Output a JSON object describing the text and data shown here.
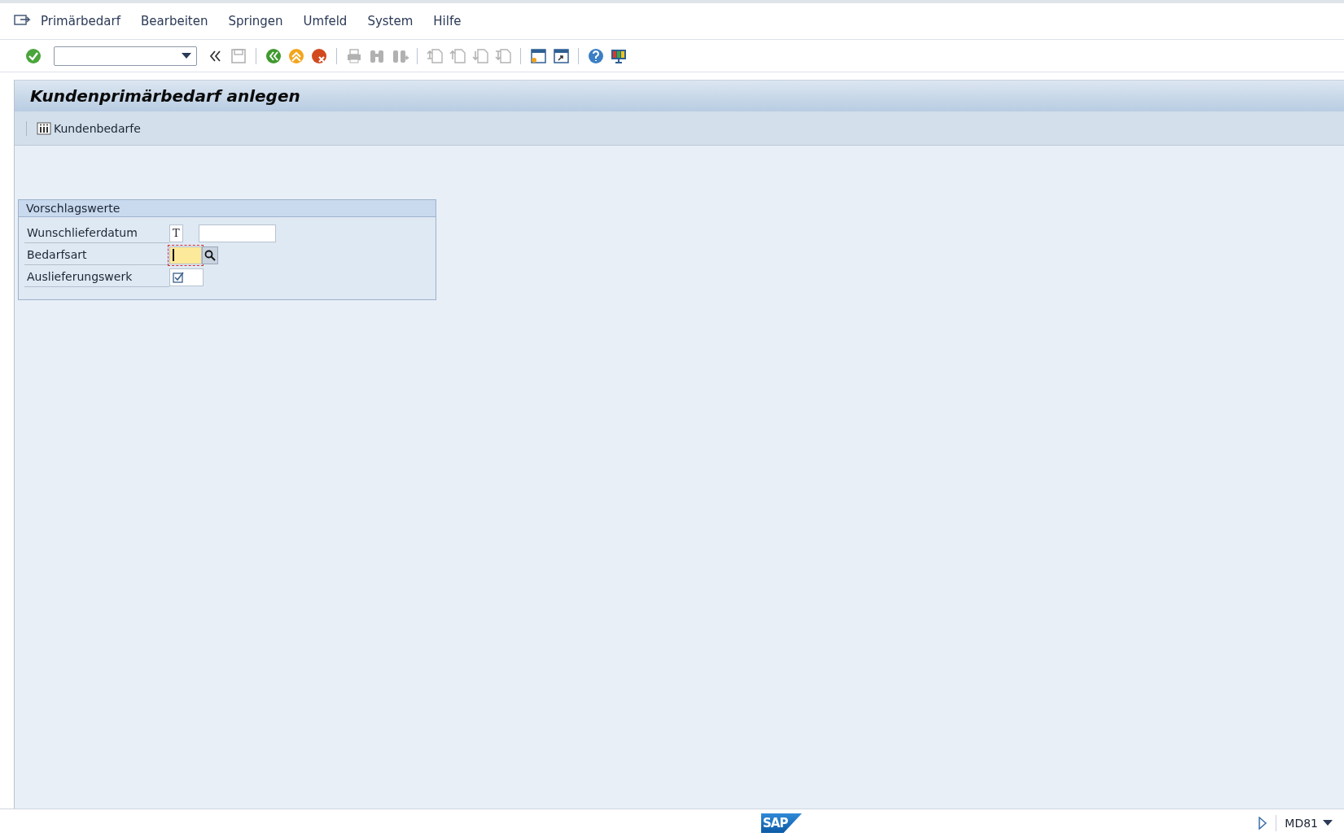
{
  "menu": [
    {
      "label": "Primärbedarf"
    },
    {
      "label": "Bearbeiten"
    },
    {
      "label": "Springen"
    },
    {
      "label": "Umfeld"
    },
    {
      "label": "System"
    },
    {
      "label": "Hilfe"
    }
  ],
  "toolbar": [
    {
      "kind": "enter",
      "disabled": false
    },
    {
      "kind": "command_field",
      "disabled": false
    },
    {
      "kind": "collapse",
      "disabled": false
    },
    {
      "kind": "save",
      "disabled": true
    },
    {
      "kind": "separator"
    },
    {
      "kind": "back",
      "disabled": false
    },
    {
      "kind": "exit",
      "disabled": false
    },
    {
      "kind": "cancel",
      "disabled": false
    },
    {
      "kind": "separator"
    },
    {
      "kind": "print",
      "disabled": true
    },
    {
      "kind": "find",
      "disabled": true
    },
    {
      "kind": "find_next",
      "disabled": true
    },
    {
      "kind": "separator"
    },
    {
      "kind": "first_page",
      "disabled": true
    },
    {
      "kind": "prev_page",
      "disabled": true
    },
    {
      "kind": "next_page",
      "disabled": true
    },
    {
      "kind": "last_page",
      "disabled": true
    },
    {
      "kind": "separator"
    },
    {
      "kind": "new_session",
      "disabled": false
    },
    {
      "kind": "shortcut",
      "disabled": false
    },
    {
      "kind": "separator"
    },
    {
      "kind": "help",
      "disabled": false
    },
    {
      "kind": "layout",
      "disabled": false
    }
  ],
  "title": "Kundenprimärbedarf anlegen",
  "app_toolbar": [
    {
      "label": "Kundenbedarfe"
    }
  ],
  "group": {
    "title": "Vorschlagswerte",
    "rows": [
      {
        "label": "Wunschlieferdatum",
        "kind": "date",
        "prefix": "T",
        "focused": false
      },
      {
        "label": "Bedarfsart",
        "kind": "search",
        "focused": true
      },
      {
        "label": "Auslieferungswerk",
        "kind": "checkbox",
        "checked": true
      }
    ]
  },
  "status_bar": {
    "logo": "SAP",
    "transaction": "MD81"
  }
}
